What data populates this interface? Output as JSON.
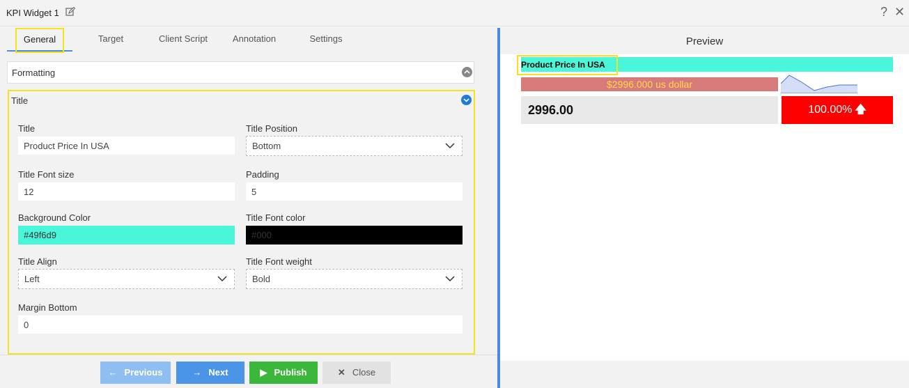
{
  "header": {
    "title": "KPI Widget 1",
    "help_glyph": "?",
    "close_glyph": "✕"
  },
  "tabs": [
    {
      "label": "General",
      "active": true
    },
    {
      "label": "Target"
    },
    {
      "label": "Client Script"
    },
    {
      "label": "Annotation"
    },
    {
      "label": "Settings"
    }
  ],
  "formatting": {
    "label": "Formatting"
  },
  "title_section": {
    "heading": "Title",
    "fields": {
      "title": {
        "label": "Title",
        "value": "Product Price In USA"
      },
      "title_position": {
        "label": "Title Position",
        "value": "Bottom"
      },
      "title_font_size": {
        "label": "Title Font size",
        "value": "12"
      },
      "padding": {
        "label": "Padding",
        "value": "5"
      },
      "background_color": {
        "label": "Background Color",
        "value": "#49f6d9"
      },
      "title_font_color": {
        "label": "Title Font color",
        "value": "#000"
      },
      "title_align": {
        "label": "Title Align",
        "value": "Left"
      },
      "title_font_weight": {
        "label": "Title Font weight",
        "value": "Bold"
      },
      "margin_bottom": {
        "label": "Margin Bottom",
        "value": "0"
      }
    }
  },
  "buttons": {
    "previous": "Previous",
    "next": "Next",
    "publish": "Publish",
    "close": "Close"
  },
  "preview": {
    "heading": "Preview",
    "kpi_title": "Product Price In USA",
    "kpi_subtitle": "$2996.000 us dollar",
    "kpi_value": "2996.00",
    "kpi_percent": "100.00%"
  },
  "colors": {
    "accent": "#4a8ae0",
    "highlight": "#f5e21a",
    "teal": "#49f6d9",
    "red": "#ff0000",
    "publish_green": "#3bb83a"
  }
}
